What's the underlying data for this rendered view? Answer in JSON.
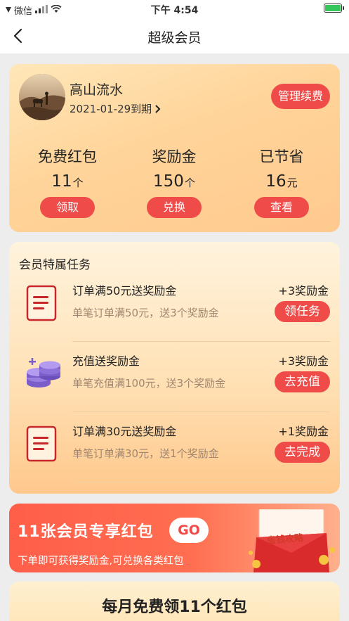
{
  "status_bar": {
    "carrier": "微信",
    "time": "下午 4:54"
  },
  "nav": {
    "title": "超级会员"
  },
  "member": {
    "name": "高山流水",
    "expire_text": "2021-01-29到期",
    "renew_label": "管理续费",
    "stats": [
      {
        "label": "免费红包",
        "value": "11",
        "unit": "个",
        "button": "领取"
      },
      {
        "label": "奖励金",
        "value": "150",
        "unit": "个",
        "button": "兑换"
      },
      {
        "label": "已节省",
        "value": "16",
        "unit": "元",
        "button": "查看"
      }
    ]
  },
  "tasks": {
    "title": "会员特属任务",
    "items": [
      {
        "icon": "document-icon",
        "name": "订单满50元送奖励金",
        "desc": "单笔订单满50元，送3个奖励金",
        "reward": "+3奖励金",
        "button": "领任务"
      },
      {
        "icon": "coins-icon",
        "name": "充值送奖励金",
        "desc": "单笔充值满100元，送3个奖励金",
        "reward": "+3奖励金",
        "button": "去充值"
      },
      {
        "icon": "document-icon",
        "name": "订单满30元送奖励金",
        "desc": "单笔订单满30元，送1个奖励金",
        "reward": "+1奖励金",
        "button": "去完成"
      }
    ]
  },
  "banner": {
    "title": "11张会员专享红包",
    "go_label": "GO",
    "subtitle": "下单即可获得奖励金,可兑换各类红包",
    "tag": "省钱攻略"
  },
  "monthly": {
    "title": "每月免费领11个红包"
  },
  "colors": {
    "accent": "#ef4b48",
    "card_bg": "#ffd49a",
    "muted_text": "#a08670"
  }
}
